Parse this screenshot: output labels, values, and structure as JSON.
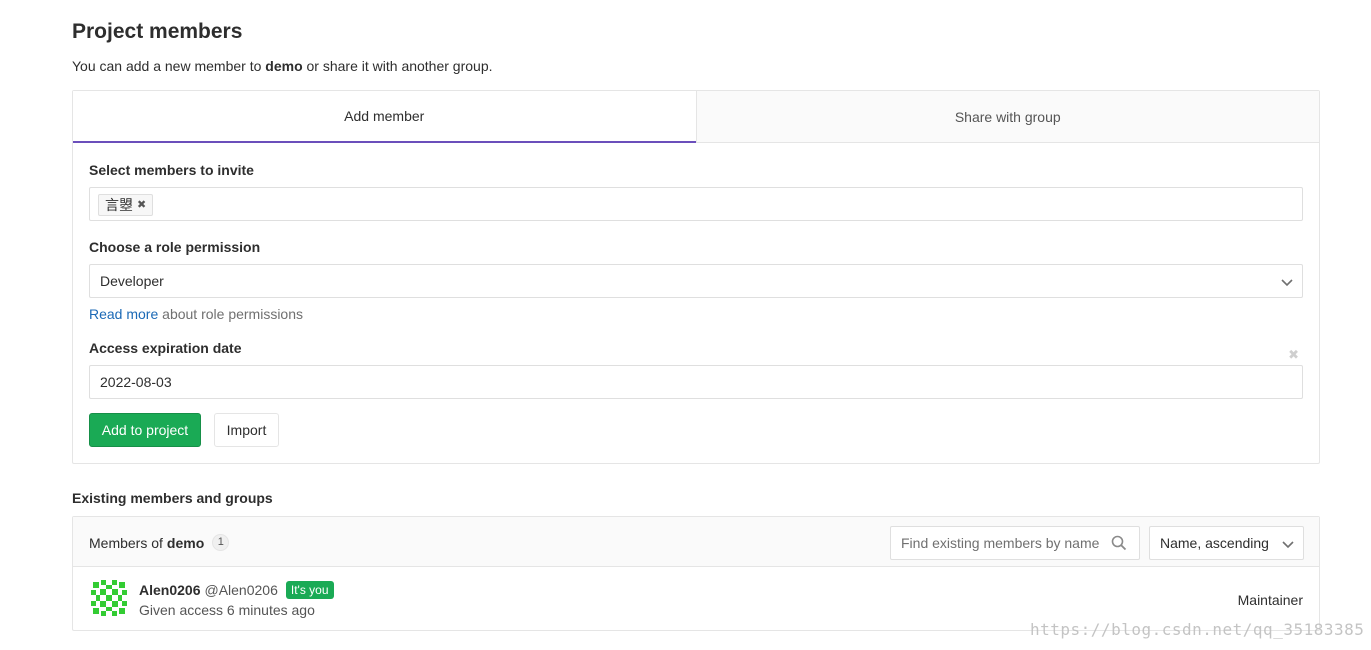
{
  "header": {
    "title": "Project members",
    "subtitle_before": "You can add a new member to ",
    "subtitle_project": "demo",
    "subtitle_after": " or share it with another group."
  },
  "tabs": [
    {
      "label": "Add member",
      "active": true
    },
    {
      "label": "Share with group",
      "active": false
    }
  ],
  "form": {
    "invite_label": "Select members to invite",
    "invite_token": "言曌",
    "role_label": "Choose a role permission",
    "role_value": "Developer",
    "help_link": "Read more",
    "help_text": " about role permissions",
    "expiration_label": "Access expiration date",
    "expiration_value": "2022-08-03",
    "add_button": "Add to project",
    "import_button": "Import"
  },
  "existing": {
    "title": "Existing members and groups",
    "members_of": "Members of ",
    "project": "demo",
    "count": "1",
    "search_placeholder": "Find existing members by name",
    "sort_value": "Name, ascending",
    "members": [
      {
        "name": "Alen0206",
        "handle": "@Alen0206",
        "badge": "It's you",
        "access": "Given access 6 minutes ago",
        "role": "Maintainer"
      }
    ]
  },
  "watermark": "https://blog.csdn.net/qq_35183385",
  "colors": {
    "accent_tab": "#6b4fbb",
    "success": "#1aaa55",
    "link": "#1b69b6"
  }
}
